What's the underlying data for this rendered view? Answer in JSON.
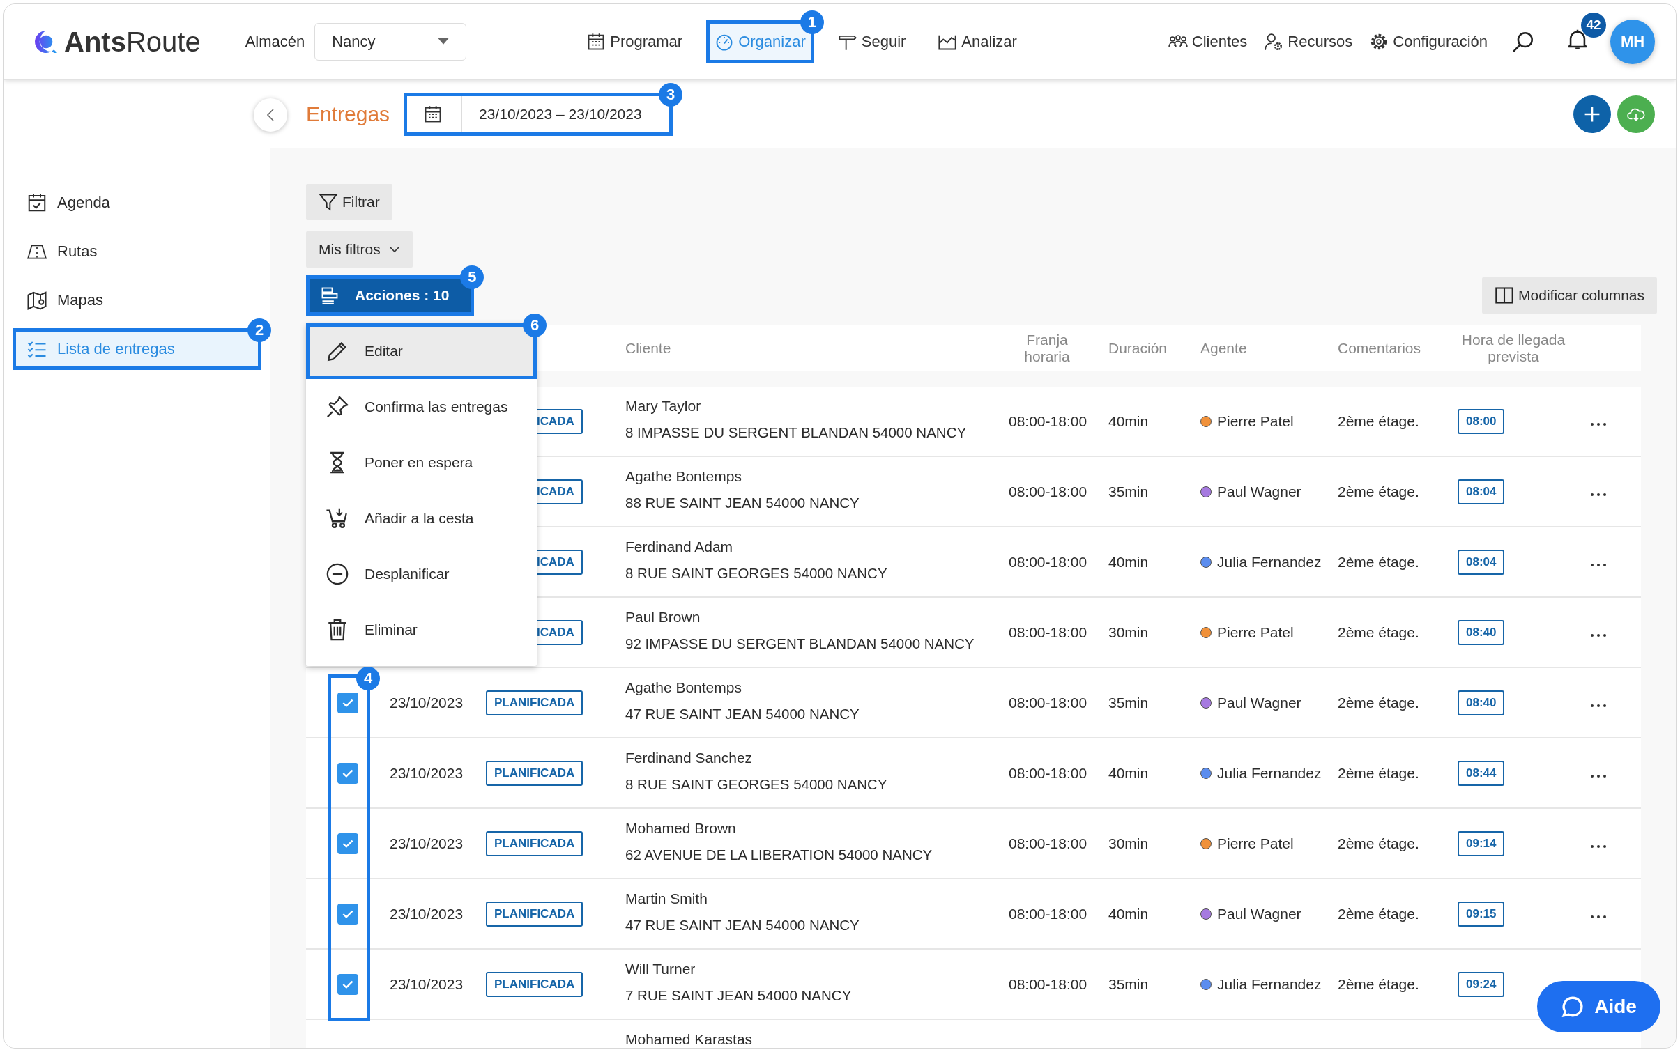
{
  "header": {
    "logo": "**Ants**Route",
    "warehouse_label": "Almacén",
    "warehouse_select": "Nancy",
    "nav": [
      {
        "label": "Programar",
        "selected": false
      },
      {
        "label": "Organizar",
        "selected": true,
        "callout": "1"
      },
      {
        "label": "Seguir",
        "selected": false
      },
      {
        "label": "Analizar",
        "selected": false
      }
    ],
    "right_nav": [
      {
        "label": "Clientes"
      },
      {
        "label": "Recursos"
      },
      {
        "label": "Configuración"
      }
    ],
    "notifications": "42",
    "avatar": "MH"
  },
  "sidebar": {
    "items": [
      {
        "label": "Agenda",
        "selected": false
      },
      {
        "label": "Rutas",
        "selected": false
      },
      {
        "label": "Mapas",
        "selected": false
      },
      {
        "label": "Lista de entregas",
        "selected": true,
        "callout": "2"
      }
    ]
  },
  "page": {
    "title": "Entregas",
    "date_range": "23/10/2023 – 23/10/2023",
    "date_range_callout": "3"
  },
  "toolbar": {
    "filter": "Filtrar",
    "my_filters": "Mis filtros",
    "actions": "Acciones : 10",
    "actions_callout": "5",
    "modify_columns": "Modificar columnas"
  },
  "actions_menu": {
    "items": [
      {
        "label": "Editar",
        "selected": true,
        "callout": "6"
      },
      {
        "label": "Confirma las entregas",
        "selected": false
      },
      {
        "label": "Poner en espera",
        "selected": false
      },
      {
        "label": "Añadir a la cesta",
        "selected": false
      },
      {
        "label": "Desplanificar",
        "selected": false
      },
      {
        "label": "Eliminar",
        "selected": false
      }
    ]
  },
  "table": {
    "columns": [
      "Cliente",
      "Franja horaria",
      "Duración",
      "Agente",
      "Comentarios",
      "Hora de llegada prevista"
    ],
    "checkbox_callout": "4",
    "rows": [
      {
        "status": "ICADA",
        "client": "Mary Taylor",
        "address": "8 IMPASSE DU SERGENT BLANDAN 54000 NANCY",
        "window": "08:00-18:00",
        "duration": "40min",
        "agent": "Pierre Patel",
        "color": "#f0913a",
        "comment": "2ème étage.",
        "eta": "08:00",
        "more": true
      },
      {
        "status": "ICADA",
        "client": "Agathe Bontemps",
        "address": "88 RUE SAINT JEAN 54000 NANCY",
        "window": "08:00-18:00",
        "duration": "35min",
        "agent": "Paul Wagner",
        "color": "#a67ae0",
        "comment": "2ème étage.",
        "eta": "08:04",
        "more": true
      },
      {
        "status": "ICADA",
        "client": "Ferdinand Adam",
        "address": "8 RUE SAINT GEORGES 54000 NANCY",
        "window": "08:00-18:00",
        "duration": "40min",
        "agent": "Julia Fernandez",
        "color": "#5b8def",
        "comment": "2ème étage.",
        "eta": "08:04",
        "more": true
      },
      {
        "status": "ICADA",
        "client": "Paul Brown",
        "address": "92 IMPASSE DU SERGENT BLANDAN 54000 NANCY",
        "window": "08:00-18:00",
        "duration": "30min",
        "agent": "Pierre Patel",
        "color": "#f0913a",
        "comment": "2ème étage.",
        "eta": "08:40",
        "more": true
      },
      {
        "checked": true,
        "date": "23/10/2023",
        "status": "PLANIFICADA",
        "client": "Agathe Bontemps",
        "address": "47 RUE SAINT JEAN 54000 NANCY",
        "window": "08:00-18:00",
        "duration": "35min",
        "agent": "Paul Wagner",
        "color": "#a67ae0",
        "comment": "2ème étage.",
        "eta": "08:40",
        "more": true
      },
      {
        "checked": true,
        "date": "23/10/2023",
        "status": "PLANIFICADA",
        "client": "Ferdinand Sanchez",
        "address": "8 RUE SAINT GEORGES 54000 NANCY",
        "window": "08:00-18:00",
        "duration": "40min",
        "agent": "Julia Fernandez",
        "color": "#5b8def",
        "comment": "2ème étage.",
        "eta": "08:44",
        "more": true
      },
      {
        "checked": true,
        "date": "23/10/2023",
        "status": "PLANIFICADA",
        "client": "Mohamed Brown",
        "address": "62 AVENUE DE LA LIBERATION 54000 NANCY",
        "window": "08:00-18:00",
        "duration": "30min",
        "agent": "Pierre Patel",
        "color": "#f0913a",
        "comment": "2ème étage.",
        "eta": "09:14",
        "more": true
      },
      {
        "checked": true,
        "date": "23/10/2023",
        "status": "PLANIFICADA",
        "client": "Martin Smith",
        "address": "47 RUE SAINT JEAN 54000 NANCY",
        "window": "08:00-18:00",
        "duration": "40min",
        "agent": "Paul Wagner",
        "color": "#a67ae0",
        "comment": "2ème étage.",
        "eta": "09:15",
        "more": true
      },
      {
        "checked": true,
        "date": "23/10/2023",
        "status": "PLANIFICADA",
        "client": "Will Turner",
        "address": "7 RUE SAINT JEAN 54000 NANCY",
        "window": "08:00-18:00",
        "duration": "35min",
        "agent": "Julia Fernandez",
        "color": "#5b8def",
        "comment": "2ème étage.",
        "eta": "09:24",
        "more": false
      },
      {
        "client": "Mohamed Karastas"
      }
    ]
  },
  "help_button": "Aide"
}
